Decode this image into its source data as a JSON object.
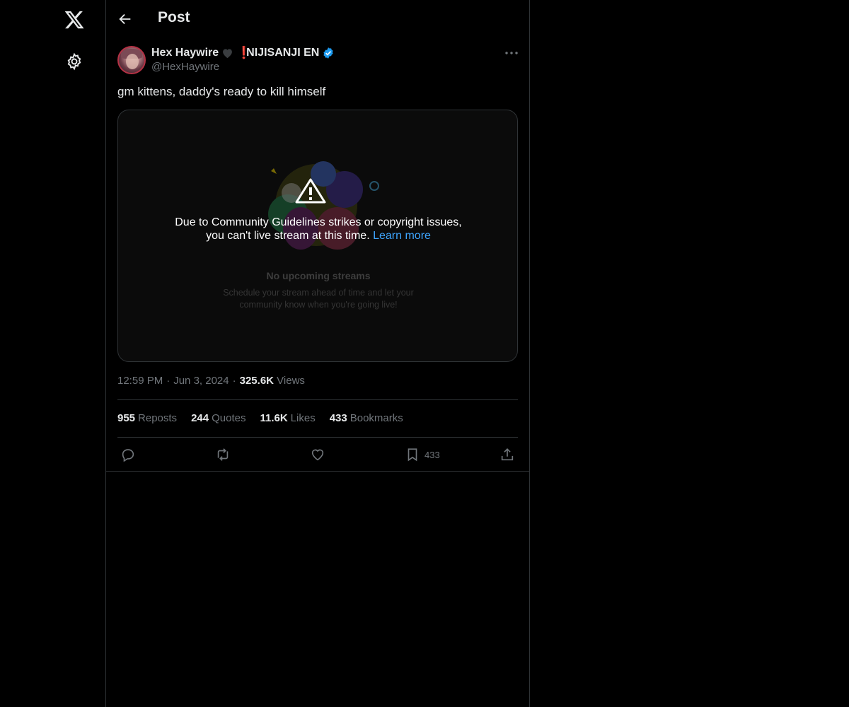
{
  "header": {
    "title": "Post"
  },
  "author": {
    "display_name": "Hex Haywire",
    "exclaim": "❗",
    "affiliation": "NIJISANJI EN",
    "handle": "@HexHaywire",
    "verified": true
  },
  "post": {
    "text": "gm kittens, daddy's ready to kill himself"
  },
  "media": {
    "warning_line1": "Due to Community Guidelines strikes or copyright issues,",
    "warning_line2_prefix": "you can't live stream at this time. ",
    "learn_more": "Learn more",
    "no_streams": "No upcoming streams",
    "schedule_line1": "Schedule your stream ahead of time and let your",
    "schedule_line2": "community know when you're going live!"
  },
  "meta": {
    "time": "12:59 PM",
    "date": "Jun 3, 2024",
    "views_count": "325.6K",
    "views_label": "Views",
    "separator": "·"
  },
  "stats": {
    "reposts_count": "955",
    "reposts_label": "Reposts",
    "quotes_count": "244",
    "quotes_label": "Quotes",
    "likes_count": "11.6K",
    "likes_label": "Likes",
    "bookmarks_count": "433",
    "bookmarks_label": "Bookmarks"
  },
  "actions": {
    "bookmark_count": "433"
  },
  "icons": {
    "logo": "x-logo-icon",
    "settings": "gear-icon",
    "back": "arrow-left-icon",
    "more": "more-horizontal-icon",
    "reply": "reply-icon",
    "repost": "repost-icon",
    "like": "heart-icon",
    "bookmark": "bookmark-icon",
    "share": "share-icon",
    "verified": "verified-badge-icon",
    "warning": "warning-triangle-icon"
  },
  "colors": {
    "background": "#000000",
    "text": "#e7e9ea",
    "muted": "#71767b",
    "border": "#2f3336",
    "verified": "#1d9bf0",
    "link": "#3ea6ff",
    "alert_red": "#e0222f"
  }
}
